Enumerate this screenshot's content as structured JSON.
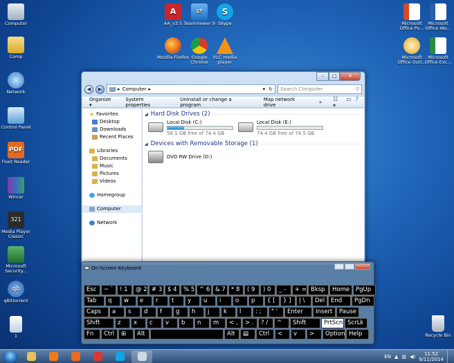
{
  "desktop_icons": [
    {
      "label": "Computer",
      "icon": "computer-icon",
      "color": "#cfd8e3"
    },
    {
      "label": "Comp",
      "icon": "folder-icon",
      "color": "#e8c15a"
    },
    {
      "label": "Network",
      "icon": "network-icon",
      "color": "#5fa4d8"
    },
    {
      "label": "Control Panel",
      "icon": "control-panel-icon",
      "color": "#6fb0e0"
    },
    {
      "label": "Foxit Reader",
      "icon": "foxit-reader-icon",
      "color": "#e36a1f"
    },
    {
      "label": "Winrar",
      "icon": "winrar-icon",
      "color": "#8a3a9c"
    },
    {
      "label": "Media Player Classic",
      "icon": "media-player-classic-icon",
      "color": "#2b2b2b"
    },
    {
      "label": "Microsoft Security...",
      "icon": "microsoft-security-icon",
      "color": "#2f7c3d"
    },
    {
      "label": "qBittorrent",
      "icon": "qbittorrent-icon",
      "color": "#3a75c8"
    },
    {
      "label": "1",
      "icon": "file-icon",
      "color": "#e6eef6"
    },
    {
      "label": "AA_v3.5",
      "icon": "aa-icon",
      "color": "#c9262c"
    },
    {
      "label": "TeamViewer 9",
      "icon": "teamviewer-icon",
      "color": "#1f72c6"
    },
    {
      "label": "Skype",
      "icon": "skype-icon",
      "color": "#12a5e6"
    },
    {
      "label": "Mozilla Firefox",
      "icon": "firefox-icon",
      "color": "#e96a1e"
    },
    {
      "label": "Google Chrome",
      "icon": "chrome-icon",
      "color": "#d8392c"
    },
    {
      "label": "VLC media player",
      "icon": "vlc-icon",
      "color": "#f29219"
    },
    {
      "label": "Microsoft Office Po...",
      "icon": "powerpoint-icon",
      "color": "#d44b23"
    },
    {
      "label": "Microsoft Office Wo...",
      "icon": "word-icon",
      "color": "#2a5fac"
    },
    {
      "label": "Microsoft Office Outl...",
      "icon": "outlook-icon",
      "color": "#e6a321"
    },
    {
      "label": "Microsoft Office Exc...",
      "icon": "excel-icon",
      "color": "#2a8a45"
    },
    {
      "label": "Recycle Bin",
      "icon": "recycle-bin-icon",
      "color": "#bcc7d2"
    }
  ],
  "explorer": {
    "address": "Computer",
    "search_placeholder": "Search Computer",
    "toolbar": [
      "Organize ▾",
      "System properties",
      "Uninstall or change a program",
      "Map network drive",
      "»"
    ],
    "favorites": "Favorites",
    "favorite_items": [
      "Desktop",
      "Downloads",
      "Recent Places"
    ],
    "libraries": "Libraries",
    "library_items": [
      "Documents",
      "Music",
      "Pictures",
      "Videos"
    ],
    "homegroup": "Homegroup",
    "computer": "Computer",
    "network": "Network",
    "hdd_group": "Hard Disk Drives (2)",
    "removable_group": "Devices with Removable Storage (1)",
    "drives": [
      {
        "name": "Local Disk (C:)",
        "free": "56.1 GB free of 74.4 GB",
        "used_fraction": 0.25
      },
      {
        "name": "Local Disk (E:)",
        "free": "74.4 GB free of 74.5 GB",
        "used_fraction": 0.0
      }
    ],
    "dvd": "DVD RW Drive (D:)"
  },
  "keyboard": {
    "title": "On-Screen Keyboard",
    "rows": [
      [
        "Esc",
        "~ `",
        "! 1",
        "@ 2",
        "# 3",
        "$ 4",
        "% 5",
        "^ 6",
        "& 7",
        "* 8",
        "( 9",
        ") 0",
        "_ -",
        "+ =",
        "Bksp",
        "Home",
        "PgUp"
      ],
      [
        "Tab",
        "q",
        "w",
        "e",
        "r",
        "t",
        "y",
        "u",
        "i",
        "o",
        "p",
        "{ [",
        "} ]",
        "| \\",
        "Del",
        "End",
        "PgDn"
      ],
      [
        "Caps",
        "a",
        "s",
        "d",
        "f",
        "g",
        "h",
        "j",
        "k",
        "l",
        ": ;",
        "\" '",
        "Enter",
        "Insert",
        "Pause"
      ],
      [
        "Shift",
        "z",
        "x",
        "c",
        "v",
        "b",
        "n",
        "m",
        "< ,",
        "> .",
        "? /",
        "^",
        "Shift",
        "PrtScn",
        "ScrLk"
      ],
      [
        "Fn",
        "Ctrl",
        "⊞",
        "Alt",
        "",
        "Alt",
        "▤",
        "Ctrl",
        "<",
        "v",
        ">",
        "Options",
        "Help"
      ]
    ]
  },
  "taskbar": {
    "apps": [
      {
        "name": "taskbar-explorer-button",
        "color": "#e8c15a"
      },
      {
        "name": "taskbar-media-button",
        "color": "#ef7a1a"
      },
      {
        "name": "taskbar-firefox-button",
        "color": "#e96a1e"
      },
      {
        "name": "taskbar-chrome-button",
        "color": "#d8392c"
      },
      {
        "name": "taskbar-skype-button",
        "color": "#12a5e6"
      },
      {
        "name": "taskbar-osk-button",
        "color": "#cfd8e3"
      }
    ],
    "lang": "EN",
    "time": "11:52",
    "date": "9/11/2014"
  }
}
